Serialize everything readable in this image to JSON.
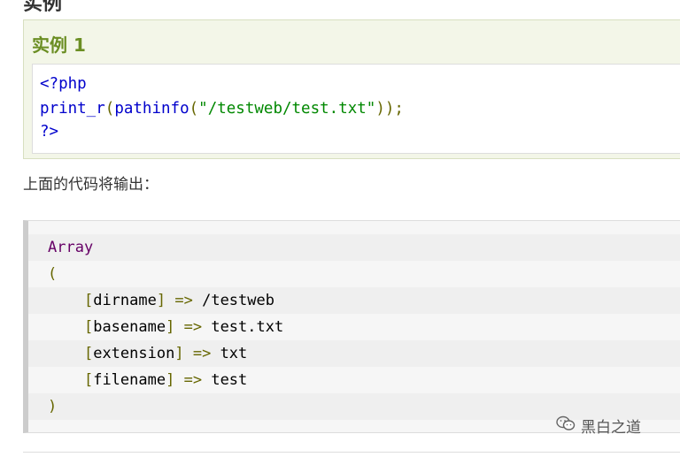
{
  "page": {
    "heading_partial": "实例"
  },
  "example": {
    "title": "实例 1",
    "code": {
      "line1": {
        "open_tag": "<?php"
      },
      "line2": {
        "func": "print_r",
        "paren_open": "(",
        "inner_func": "pathinfo",
        "inner_paren_open": "(",
        "string": "\"/testweb/test.txt\"",
        "close": "));"
      },
      "line3": {
        "close_tag": "?>"
      }
    }
  },
  "caption": "上面的代码将输出：",
  "output": {
    "lines": [
      {
        "type": "Array"
      },
      {
        "paren": "("
      },
      {
        "key_open": "[",
        "key": "dirname",
        "key_close": "]",
        "arrow": "=>",
        "value": "/testweb"
      },
      {
        "key_open": "[",
        "key": "basename",
        "key_close": "]",
        "arrow": "=>",
        "value": "test.txt"
      },
      {
        "key_open": "[",
        "key": "extension",
        "key_close": "]",
        "arrow": "=>",
        "value": "txt"
      },
      {
        "key_open": "[",
        "key": "filename",
        "key_close": "]",
        "arrow": "=>",
        "value": "test"
      },
      {
        "paren": ")"
      }
    ]
  },
  "watermark": {
    "text": "黑白之道",
    "icon": "wechat-icon"
  }
}
